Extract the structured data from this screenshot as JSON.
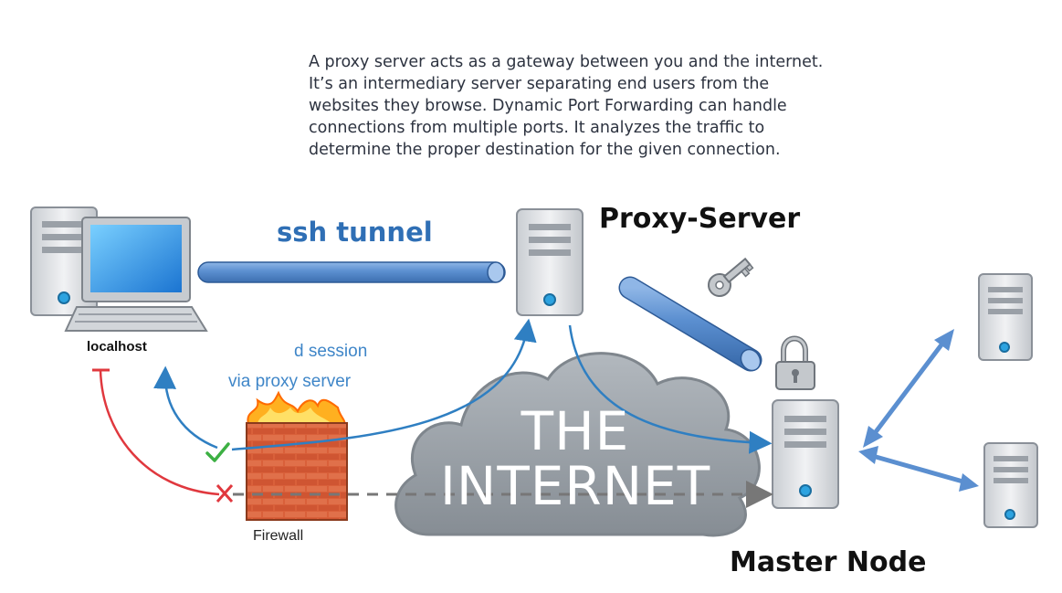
{
  "description": {
    "lines": [
      "A proxy server acts as a gateway between you and the internet.",
      "It’s an intermediary server separating end users from the",
      "websites they browse. Dynamic Port Forwarding can handle",
      "connections from multiple ports. It analyzes the traffic to",
      "determine the proper destination for the given connection."
    ]
  },
  "labels": {
    "proxy_server": "Proxy-Server",
    "ssh_tunnel": "ssh tunnel",
    "localhost": "localhost",
    "session": "d session",
    "via_proxy": "via proxy server",
    "firewall": "Firewall",
    "master_node": "Master Node",
    "cloud_the": "THE",
    "cloud_internet": "INTERNET"
  },
  "colors": {
    "tunnel_blue": "#5b8fd0",
    "arrow_blue": "#2f7fc2",
    "blocked_red": "#e0383e",
    "allowed_green": "#3cb043",
    "cloud_gray": "#9aa1a8",
    "server_gray": "#d6d9dd",
    "text_blue": "#2f6fb5"
  },
  "icons": {
    "desktop": "desktop-computer-icon",
    "server": "server-icon",
    "key": "key-icon",
    "lock": "padlock-icon",
    "firewall": "brick-firewall-icon",
    "cloud": "cloud-icon"
  }
}
